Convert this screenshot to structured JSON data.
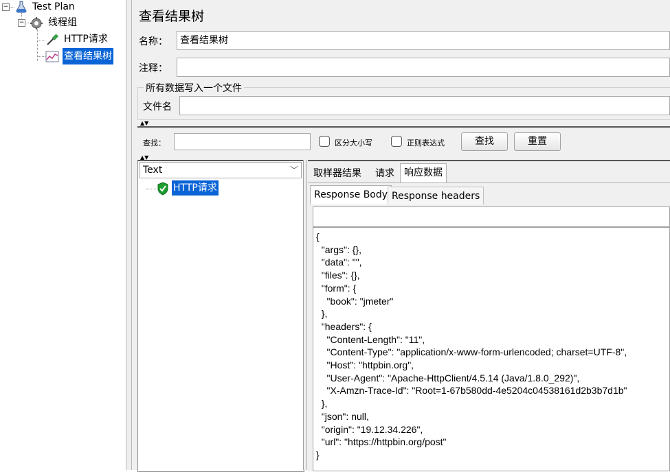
{
  "tree": {
    "nodes": [
      {
        "label": "Test Plan"
      },
      {
        "label": "线程组"
      },
      {
        "label": "HTTP请求"
      },
      {
        "label": "查看结果树"
      }
    ]
  },
  "panel": {
    "title": "查看结果树",
    "name_label": "名称：",
    "name_value": "查看结果树",
    "comment_label": "注释：",
    "comment_value": "",
    "file_group_title": "所有数据写入一个文件",
    "filename_label": "文件名",
    "filename_value": ""
  },
  "search": {
    "label": "查找：",
    "value": "",
    "case_label": "区分大小写",
    "regex_label": "正则表达式",
    "find_button": "查找",
    "reset_button": "重置"
  },
  "results": {
    "renderer": "Text",
    "items": [
      {
        "label": "HTTP请求",
        "status": "success"
      }
    ]
  },
  "detail": {
    "tabs": [
      "取样器结果",
      "请求",
      "响应数据"
    ],
    "active_tab": "响应数据",
    "subtabs": [
      "Response Body",
      "Response headers"
    ],
    "active_subtab": "Response Body",
    "body_lines": [
      "{",
      "  \"args\": {},",
      "  \"data\": \"\",",
      "  \"files\": {},",
      "  \"form\": {",
      "    \"book\": \"jmeter\"",
      "  },",
      "  \"headers\": {",
      "    \"Content-Length\": \"11\",",
      "    \"Content-Type\": \"application/x-www-form-urlencoded; charset=UTF-8\",",
      "    \"Host\": \"httpbin.org\",",
      "    \"User-Agent\": \"Apache-HttpClient/4.5.14 (Java/1.8.0_292)\",",
      "    \"X-Amzn-Trace-Id\": \"Root=1-67b580dd-4e5204c04538161d2b3b7d1b\"",
      "  },",
      "  \"json\": null,",
      "  \"origin\": \"19.12.34.226\",",
      "  \"url\": \"https://httpbin.org/post\"",
      "}"
    ]
  },
  "colors": {
    "selection": "#0a64d6",
    "success": "#1e9e2e"
  }
}
